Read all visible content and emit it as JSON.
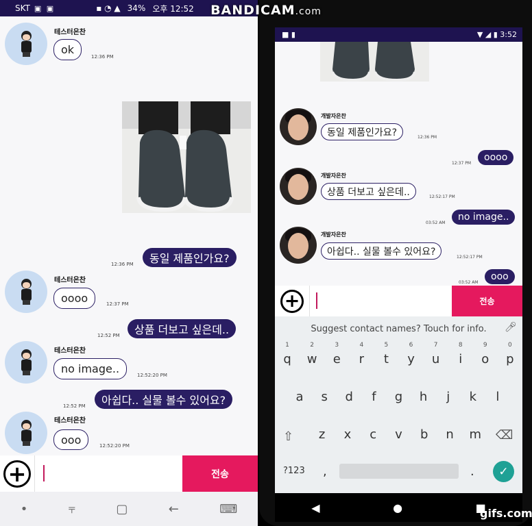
{
  "watermark": {
    "title": "BANDICAM",
    "suffix": ".com",
    "gifs": "gifs.com"
  },
  "left_status": {
    "carrier": "SKT",
    "battery": "34%",
    "clock": "오후 12:52"
  },
  "left_chat": {
    "msg1": {
      "sender": "테스터은찬",
      "text": "ok",
      "time": "12:36 PM"
    },
    "out1": {
      "text": "동일 제품인가요?",
      "time": "12:36 PM"
    },
    "msg2": {
      "sender": "테스터은찬",
      "text": "oooo",
      "time": "12:37 PM"
    },
    "out2": {
      "text": "상품 더보고 싶은데..",
      "time": "12:52 PM"
    },
    "msg3": {
      "sender": "테스터은찬",
      "text": "no image..",
      "time": "12:52:20 PM"
    },
    "out3": {
      "text": "아쉽다.. 실물 볼수 있어요?",
      "time": "12:52 PM"
    },
    "msg4": {
      "sender": "테스터은찬",
      "text": "ooo",
      "time": "12:52:20 PM"
    }
  },
  "input": {
    "plus": "+",
    "send": "전송"
  },
  "left_nav": {
    "dot": "•",
    "recent": "⫧",
    "home": "▢",
    "back": "←",
    "keyboard": "⌨"
  },
  "right_status": {
    "clock": "3:52"
  },
  "right_chat": {
    "m1": {
      "sender": "개발자은찬",
      "text": "동일 제품인가요?",
      "time": "12:36 PM"
    },
    "o1": {
      "text": "oooo",
      "time": "12:37 PM"
    },
    "m2": {
      "sender": "개발자은찬",
      "text": "상품 더보고 싶은데..",
      "time": "12:52:17 PM"
    },
    "o2": {
      "text": "no image..",
      "time": "03:52 AM"
    },
    "m3": {
      "sender": "개발자은찬",
      "text": "아쉽다.. 실물 볼수 있어요?",
      "time": "12:52:17 PM"
    },
    "o3": {
      "text": "ooo",
      "time": "03:52 AM"
    }
  },
  "keyboard": {
    "suggestion": "Suggest contact names? Touch for info.",
    "row1": [
      {
        "k": "q",
        "n": "1"
      },
      {
        "k": "w",
        "n": "2"
      },
      {
        "k": "e",
        "n": "3"
      },
      {
        "k": "r",
        "n": "4"
      },
      {
        "k": "t",
        "n": "5"
      },
      {
        "k": "y",
        "n": "6"
      },
      {
        "k": "u",
        "n": "7"
      },
      {
        "k": "i",
        "n": "8"
      },
      {
        "k": "o",
        "n": "9"
      },
      {
        "k": "p",
        "n": "0"
      }
    ],
    "row2": [
      "a",
      "s",
      "d",
      "f",
      "g",
      "h",
      "j",
      "k",
      "l"
    ],
    "row3": [
      "z",
      "x",
      "c",
      "v",
      "b",
      "n",
      "m"
    ],
    "sym": "?123",
    "comma": ",",
    "period": ".",
    "enter": "✓"
  },
  "right_nav": {
    "back": "◀",
    "home": "●",
    "recent": "■"
  }
}
